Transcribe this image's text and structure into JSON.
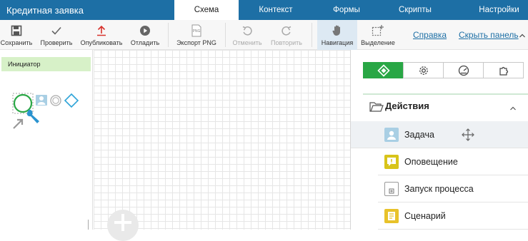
{
  "app": {
    "title": "Кредитная заявка"
  },
  "tabs": [
    {
      "label": "Схема",
      "active": true
    },
    {
      "label": "Контекст",
      "active": false
    },
    {
      "label": "Формы",
      "active": false
    },
    {
      "label": "Скрипты",
      "active": false
    },
    {
      "label": "Настройки",
      "active": false
    }
  ],
  "toolbar": {
    "save": "Сохранить",
    "check": "Проверить",
    "publish": "Опубликовать",
    "debug": "Отладить",
    "export_png": "Экспорт PNG",
    "undo": "Отменить",
    "redo": "Повторить",
    "navigation": "Навигация",
    "selection": "Выделение",
    "help": "Справка",
    "hide_panel": "Скрыть панель"
  },
  "left_panel": {
    "lane_label": "Инициатор"
  },
  "right_panel": {
    "section_title": "Действия",
    "items": [
      {
        "label": "Задача",
        "icon": "user-task-icon",
        "color": "#a9cfe4"
      },
      {
        "label": "Оповещение",
        "icon": "notification-icon",
        "color": "#d8c41a"
      },
      {
        "label": "Запуск процесса",
        "icon": "subprocess-icon",
        "color": "#ffffff"
      },
      {
        "label": "Сценарий",
        "icon": "script-icon",
        "color": "#e8c22a"
      }
    ]
  },
  "colors": {
    "header": "#1d6fa5",
    "accent_green": "#29a745",
    "link": "#1d6fa5",
    "publish_red": "#d8322c"
  }
}
